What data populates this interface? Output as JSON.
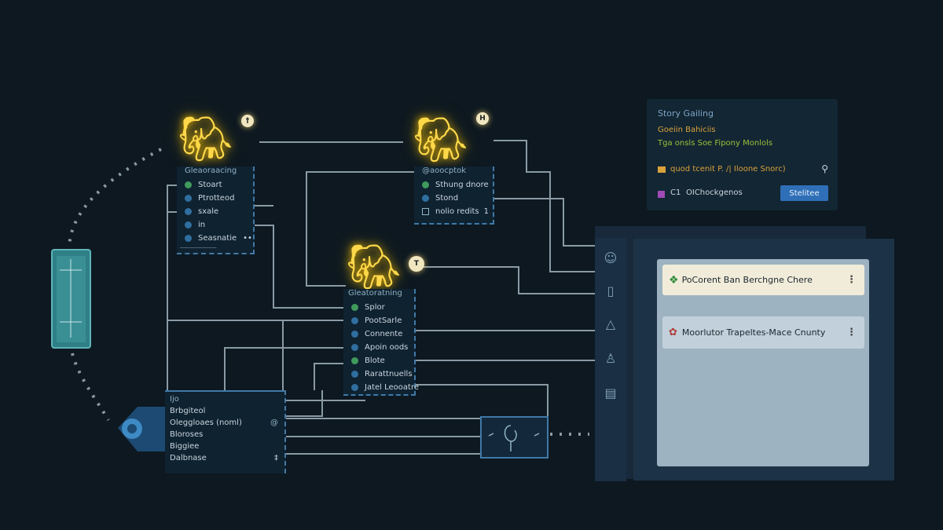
{
  "colors": {
    "background": "#0d1820",
    "elephant_glow": "#ffd84a",
    "accent_blue": "#2f6fb8",
    "connector": "#8a9aa5"
  },
  "nodes": [
    {
      "title": "Gleaoraacing",
      "badge": "†",
      "rows": [
        {
          "label": "Stoart",
          "dot": "green"
        },
        {
          "label": "Ptrotteod",
          "dot": "blue"
        },
        {
          "label": "sxale",
          "dot": "blue"
        },
        {
          "label": "in",
          "dot": "blue"
        },
        {
          "label": "Seasnatie",
          "dot": "blue",
          "suffix": "••"
        }
      ],
      "footer": "───────────"
    },
    {
      "title": "@aoocptok",
      "badge": "H",
      "rows": [
        {
          "label": "Sthung dnore",
          "dot": "green"
        },
        {
          "label": "Stond",
          "dot": "blue"
        },
        {
          "label": "nolio redits",
          "dot": "square",
          "suffix": "1"
        }
      ]
    },
    {
      "title": "Gleatoratning",
      "badge": "T",
      "rows": [
        {
          "label": "Splor",
          "dot": "green"
        },
        {
          "label": "PootSarle",
          "dot": "blue"
        },
        {
          "label": "Connente",
          "dot": "blue"
        },
        {
          "label": "Apoin oods",
          "dot": "blue"
        },
        {
          "label": "Blote",
          "dot": "green"
        },
        {
          "label": "Rarattnuells",
          "dot": "blue"
        },
        {
          "label": "Jatel Leooatre",
          "dot": "blue"
        }
      ]
    }
  ],
  "table_node": {
    "header": "Ijo",
    "rows": [
      "Brbgiteol",
      "Oleggloaes (noml)",
      "Bloroses",
      "Biggiee",
      "Dalbnase"
    ],
    "row1_icon": "@",
    "footer_icon": "‡"
  },
  "info_panel": {
    "title": "Story Gailing",
    "line1": "Goeiin Bahiciis",
    "line2": "Tga onsls Soe Fipony Monlols",
    "line3": "quod tcenit P. /| Iloone Snorc)",
    "line4_code": "C1",
    "line4_label": "OIChockgenos",
    "button_label": "Stelitee"
  },
  "cards": [
    {
      "label": "PoCorent Ban Berchgne Chere",
      "kebab": "⋮"
    },
    {
      "label": "Moorlutor Trapeltes‑Mace Cnunty",
      "kebab": "⋮"
    }
  ],
  "sidebar_icons": [
    "user-icon",
    "phone-icon",
    "bell-icon",
    "person-icon",
    "document-icon"
  ],
  "center_widget_icon": "hook-icon"
}
